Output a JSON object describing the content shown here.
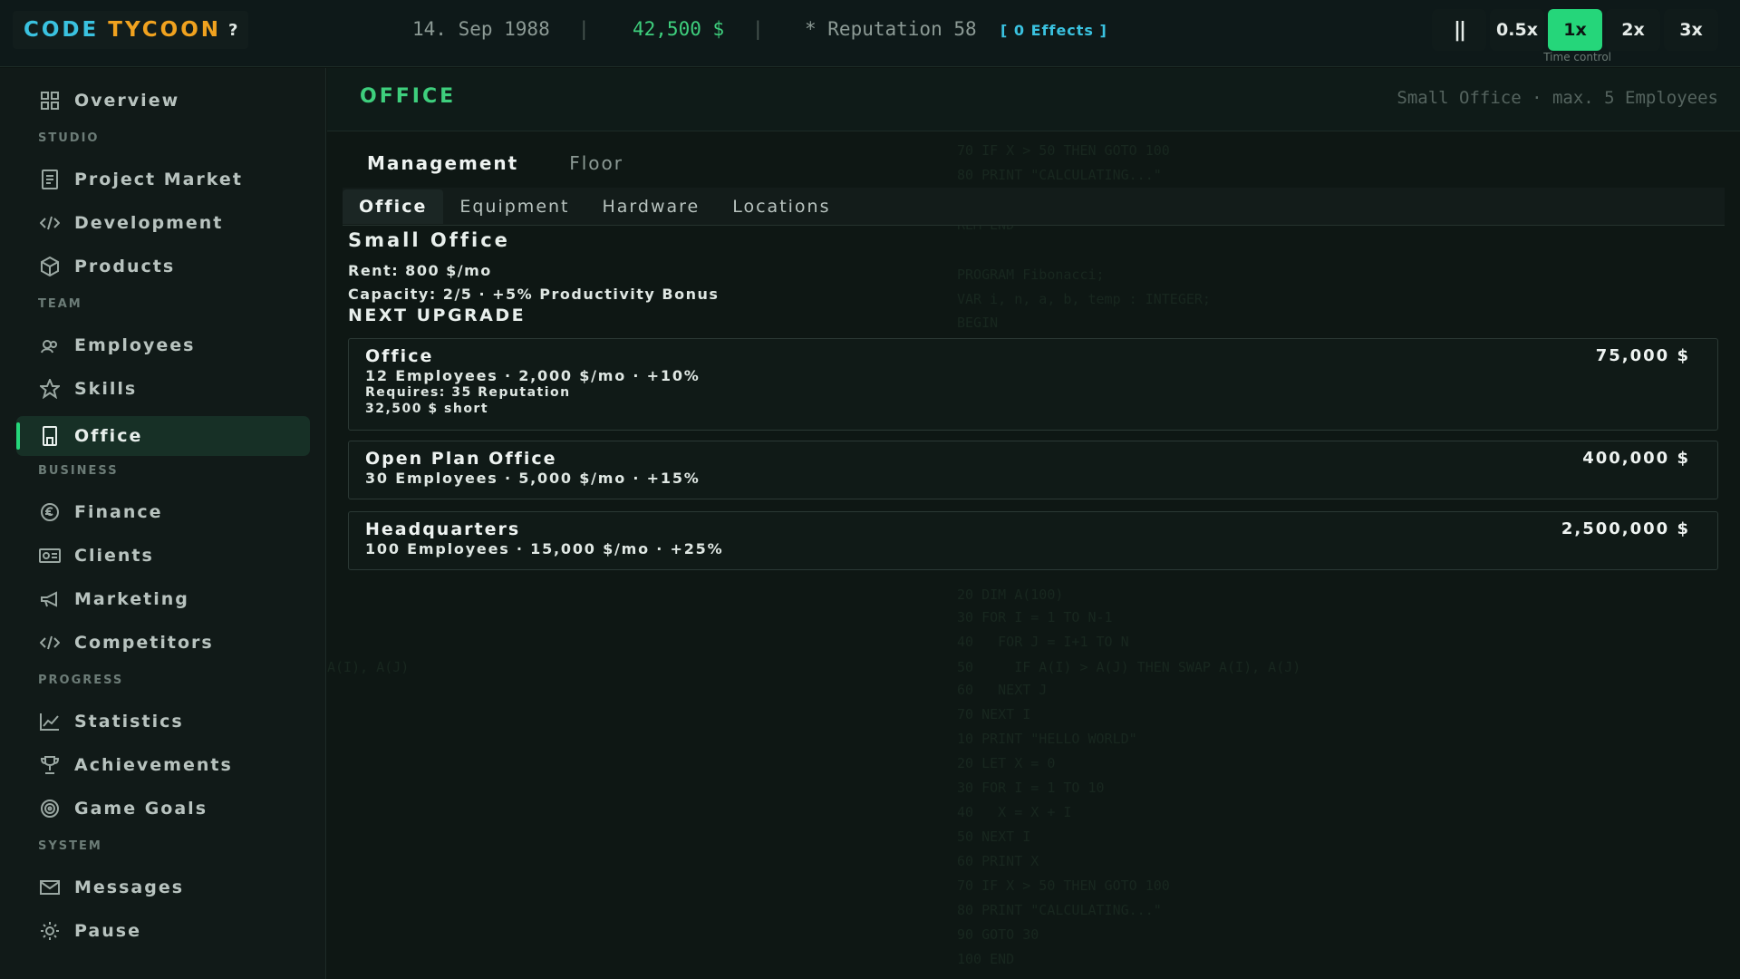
{
  "topbar": {
    "logo_word1": "CODE",
    "logo_word2": "TYCOON",
    "help": "?",
    "date": "14. Sep 1988",
    "separator": "|",
    "money": "42,500 $",
    "reputation": "* Reputation 58",
    "effects": "[ 0 Effects ]",
    "time_control": {
      "pause": "||",
      "speeds": [
        "0.5x",
        "1x",
        "2x",
        "3x"
      ],
      "active": "1x",
      "label": "Time control"
    }
  },
  "sidebar": {
    "overview": "Overview",
    "sections": {
      "studio": "STUDIO",
      "team": "TEAM",
      "business": "BUSINESS",
      "progress": "PROGRESS",
      "system": "SYSTEM"
    },
    "items": {
      "project_market": "Project Market",
      "development": "Development",
      "products": "Products",
      "employees": "Employees",
      "skills": "Skills",
      "office": "Office",
      "finance": "Finance",
      "clients": "Clients",
      "marketing": "Marketing",
      "competitors": "Competitors",
      "statistics": "Statistics",
      "achievements": "Achievements",
      "game_goals": "Game Goals",
      "messages": "Messages",
      "pause": "Pause"
    },
    "active": "Office"
  },
  "main": {
    "title": "OFFICE",
    "meta": "Small Office  ·  max. 5 Employees",
    "tabs": [
      "Management",
      "Floor"
    ],
    "subtabs": [
      "Office",
      "Equipment",
      "Hardware",
      "Locations"
    ],
    "current": {
      "name": "Small Office",
      "rent": "Rent: 800 $/mo",
      "capacity": "Capacity: 2/5  ·  +5% Productivity Bonus"
    },
    "next_upgrade_label": "NEXT UPGRADE",
    "upgrades": [
      {
        "name": "Office",
        "stats": "12 Employees · 2,000 $/mo · +10%",
        "requires": "Requires: 35 Reputation",
        "short": "32,500 $ short",
        "price": "75,000 $"
      },
      {
        "name": "Open Plan Office",
        "stats": "30 Employees · 5,000 $/mo · +15%",
        "price": "400,000 $"
      },
      {
        "name": "Headquarters",
        "stats": "100 Employees · 15,000 $/mo · +25%",
        "price": "2,500,000 $"
      }
    ]
  },
  "colors": {
    "accent": "#25d67a",
    "logo_primary": "#3ac2e0",
    "logo_secondary": "#f0a21f",
    "money": "#3ecf7d",
    "background": "#0d1512"
  }
}
